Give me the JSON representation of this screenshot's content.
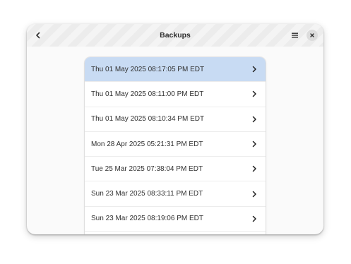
{
  "window": {
    "title": "Backups"
  },
  "headerbar": {
    "back_icon": "chevron-left-icon",
    "menu_icon": "hamburger-menu-icon",
    "close_icon": "close-icon"
  },
  "colors": {
    "selected_row": "#c8dbf3",
    "window_bg": "#fafafa"
  },
  "backups": [
    {
      "label": "Thu 01 May 2025 08:17:05 PM EDT",
      "selected": true
    },
    {
      "label": "Thu 01 May 2025 08:11:00 PM EDT",
      "selected": false
    },
    {
      "label": "Thu 01 May 2025 08:10:34 PM EDT",
      "selected": false
    },
    {
      "label": "Mon 28 Apr 2025 05:21:31 PM EDT",
      "selected": false
    },
    {
      "label": "Tue 25 Mar 2025 07:38:04 PM EDT",
      "selected": false
    },
    {
      "label": "Sun 23 Mar 2025 08:33:11 PM EDT",
      "selected": false
    },
    {
      "label": "Sun 23 Mar 2025 08:19:06 PM EDT",
      "selected": false
    }
  ]
}
